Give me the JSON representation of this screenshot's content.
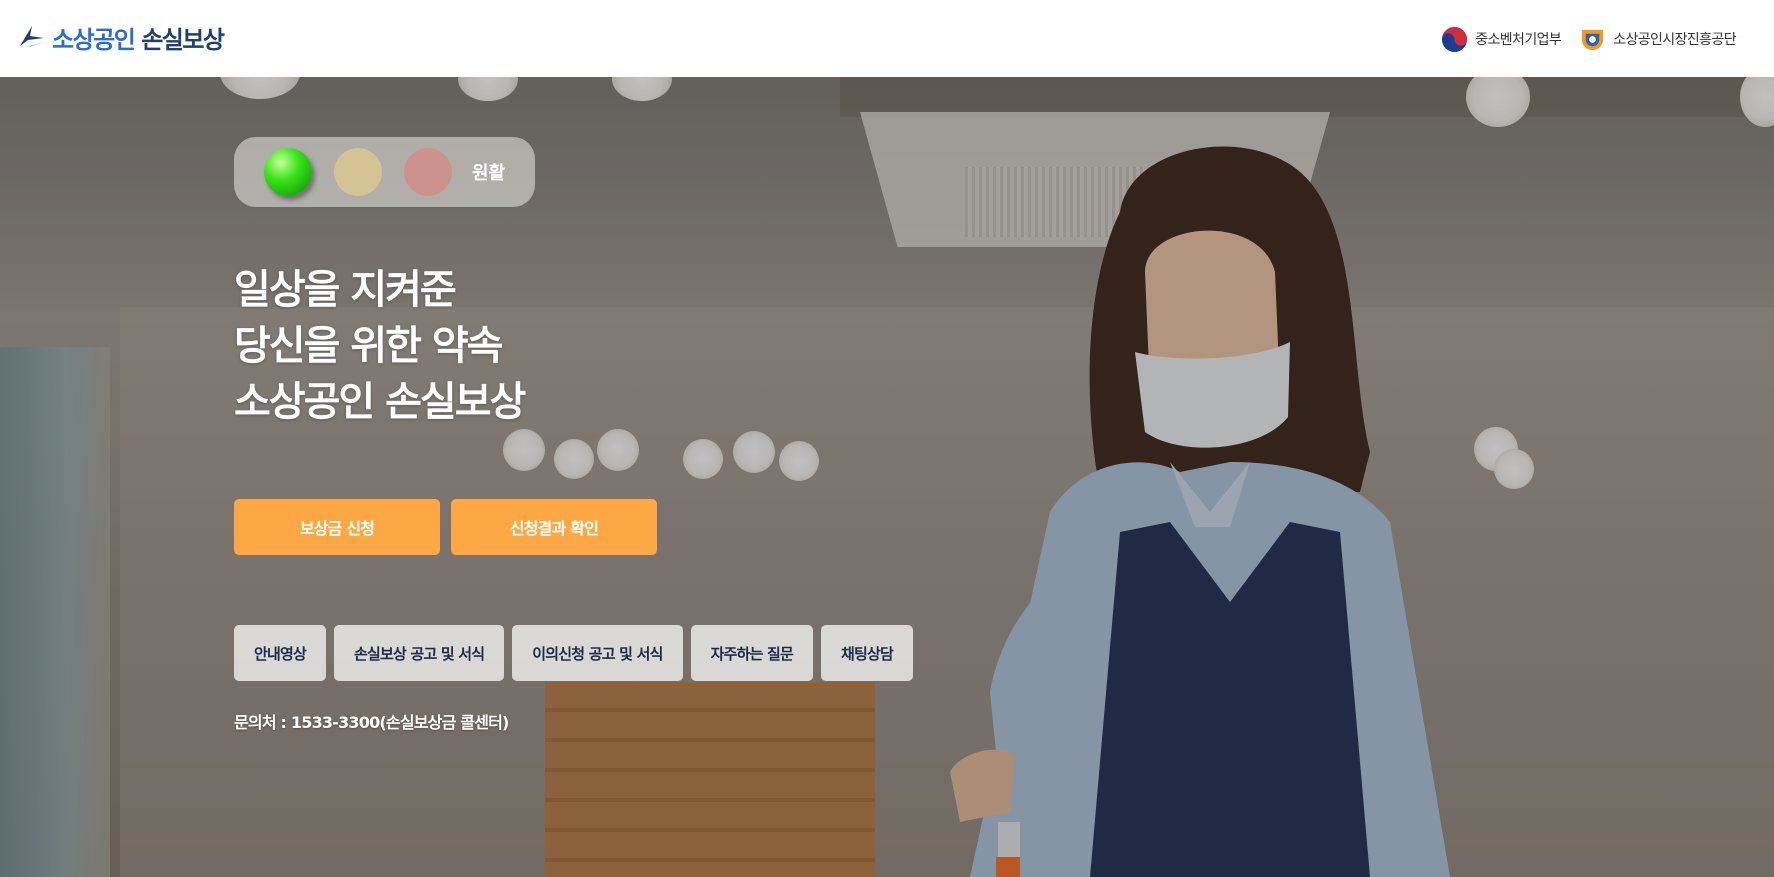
{
  "header": {
    "logo_primary": "소상공인",
    "logo_secondary": "손실보상",
    "orgs": [
      {
        "label": "중소벤처기업부",
        "icon": "korea-taegeuk-emblem-icon"
      },
      {
        "label": "소상공인시장진흥공단",
        "icon": "semas-logo-icon"
      }
    ]
  },
  "status": {
    "label": "원활",
    "active_light": "green",
    "colors": {
      "green": "#39e21a",
      "yellow": "#d9c592",
      "red": "#cf8f8a"
    }
  },
  "hero": {
    "headline": [
      "일상을 지켜준",
      "당신을 위한 약속",
      "소상공인 손실보상"
    ]
  },
  "primary_actions": {
    "apply": "보상금 신청",
    "result": "신청결과 확인"
  },
  "nav": [
    "안내영상",
    "손실보상 공고 및 서식",
    "이의신청 공고 및 서식",
    "자주하는 질문",
    "채팅상담"
  ],
  "contact": "문의처 : 1533-3300(손실보상금 콜센터)",
  "theme": {
    "accent": "#fda845",
    "brand_navy": "#1f3f73",
    "brand_blue": "#2f6cc9"
  }
}
